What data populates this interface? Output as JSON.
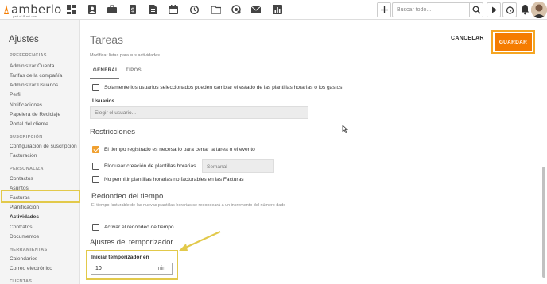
{
  "app": {
    "logo_text": "amberlo",
    "logo_sub": "part of ⊕ esi-one"
  },
  "topbar": {
    "nav_icons": [
      "dashboard-icon",
      "contacts-icon",
      "briefcase-icon",
      "invoice-icon",
      "file-icon",
      "calendar-icon",
      "timer-history-icon",
      "folder-icon",
      "settings-badge-icon",
      "mail-icon",
      "reports-icon"
    ],
    "search_placeholder": "Buscar todo...",
    "add_label": "+",
    "accent": "#f57c00"
  },
  "sidebar": {
    "title": "Ajustes",
    "sections": [
      {
        "title": "PREFERENCIAS",
        "items": [
          "Administrar Cuenta",
          "Tarifas de la compañía",
          "Administrar Usuarios",
          "Perfil",
          "Notificaciones",
          "Papelera de Reciclaje",
          "Portal del cliente"
        ]
      },
      {
        "title": "SUSCRIPCIÓN",
        "items": [
          "Configuración de suscripción",
          "Facturación"
        ]
      },
      {
        "title": "PERSONALIZA",
        "items": [
          "Contactos",
          "Asuntos",
          "Facturas",
          "Planificación",
          "Actividades",
          "Contratos",
          "Documentos"
        ]
      },
      {
        "title": "HERRAMIENTAS",
        "items": [
          "Calendarios",
          "Correo electrónico"
        ]
      },
      {
        "title": "CUENTAS",
        "items": []
      }
    ],
    "active_item": "Actividades"
  },
  "main": {
    "title": "Tareas",
    "subtitle": "Modificar listas para sus actividades",
    "cancel_label": "CANCELAR",
    "save_label": "GUARDAR",
    "tabs": [
      {
        "label": "GENERAL",
        "active": true
      },
      {
        "label": "TIPOS",
        "active": false
      }
    ],
    "status_change": {
      "label": "Solamente los usuarios seleccionados pueden cambiar el estado de las plantillas horarias o los gastos",
      "checked": false
    },
    "users": {
      "label": "Usuarios",
      "placeholder": "Elegir el usuario..."
    },
    "restrictions": {
      "title": "Restricciones",
      "items": [
        {
          "label": "El tiempo registrado es necesario para cerrar la tarea o el evento",
          "checked": true
        },
        {
          "label": "Bloquear creación de plantillas horarias",
          "checked": false,
          "select_value": "Semanal"
        },
        {
          "label": "No permitir plantillas horarias no facturables en las Facturas",
          "checked": false
        }
      ]
    },
    "rounding": {
      "title": "Redondeo del tiempo",
      "note": "El tiempo facturable de las nuevas plantillas horarias se redondeará a un incremento del número dado",
      "activate_label": "Activar el redondeo de tiempo",
      "checked": false
    },
    "timer": {
      "title": "Ajustes del temporizador",
      "field_label": "Iniciar temporizador en",
      "value": "10",
      "unit": "min"
    }
  }
}
